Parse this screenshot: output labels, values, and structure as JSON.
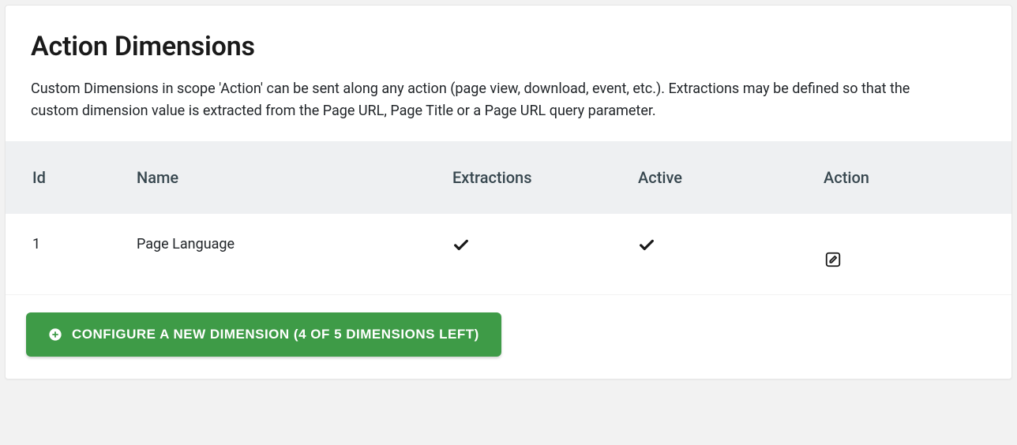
{
  "header": {
    "title": "Action Dimensions",
    "description": "Custom Dimensions in scope 'Action' can be sent along any action (page view, download, event, etc.). Extractions may be defined so that the custom dimension value is extracted from the Page URL, Page Title or a Page URL query parameter."
  },
  "table": {
    "columns": {
      "id": "Id",
      "name": "Name",
      "extractions": "Extractions",
      "active": "Active",
      "action": "Action"
    },
    "rows": [
      {
        "id": "1",
        "name": "Page Language",
        "extractions": true,
        "active": true
      }
    ]
  },
  "footer": {
    "configure_button": "CONFIGURE A NEW DIMENSION (4 OF 5 DIMENSIONS LEFT)"
  }
}
